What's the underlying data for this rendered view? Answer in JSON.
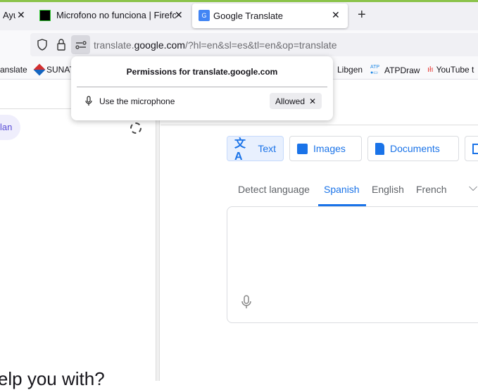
{
  "tabs": [
    {
      "label": "Ayu",
      "active": false
    },
    {
      "label": "Microfono no funciona | Firefox",
      "active": false
    },
    {
      "label": "Google Translate",
      "active": true
    }
  ],
  "new_tab_label": "+",
  "url": {
    "domain_prefix": "translate.",
    "domain": "google.com",
    "path": "/?hl=en&sl=es&tl=en&op=translate"
  },
  "bookmarks": [
    {
      "label": "anslate"
    },
    {
      "label": "SUNAT"
    },
    {
      "label": "Libgen"
    },
    {
      "label": "ATPDraw"
    },
    {
      "label": "YouTube t"
    }
  ],
  "popup": {
    "title": "Permissions for translate.google.com",
    "permission": "Use the microphone",
    "state": "Allowed"
  },
  "left": {
    "pill": "lan",
    "heading": "I help you with?"
  },
  "modes": [
    {
      "label": "Text"
    },
    {
      "label": "Images"
    },
    {
      "label": "Documents"
    }
  ],
  "languages": [
    {
      "label": "Detect language"
    },
    {
      "label": "Spanish"
    },
    {
      "label": "English"
    },
    {
      "label": "French"
    }
  ],
  "colors": {
    "accent": "#1a73e8",
    "topline": "#8bc34a"
  }
}
